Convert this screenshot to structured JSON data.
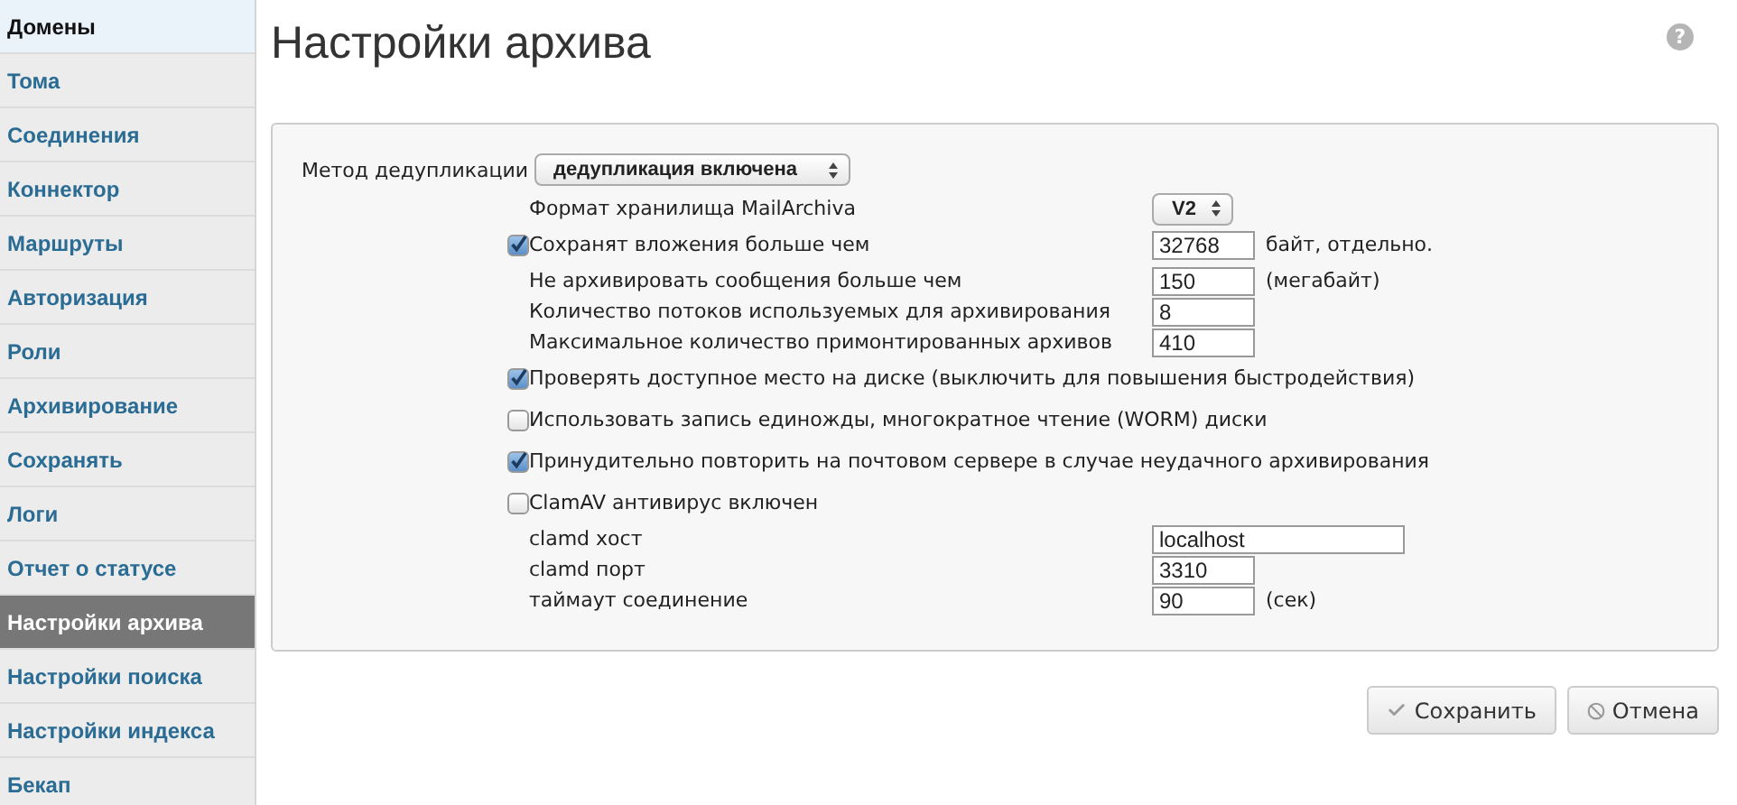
{
  "sidebar": {
    "items": [
      {
        "label": "Домены",
        "selected": false,
        "highlighted": true
      },
      {
        "label": "Тома",
        "selected": false,
        "highlighted": false
      },
      {
        "label": "Соединения",
        "selected": false,
        "highlighted": false
      },
      {
        "label": "Коннектор",
        "selected": false,
        "highlighted": false
      },
      {
        "label": "Маршруты",
        "selected": false,
        "highlighted": false
      },
      {
        "label": "Авторизация",
        "selected": false,
        "highlighted": false
      },
      {
        "label": "Роли",
        "selected": false,
        "highlighted": false
      },
      {
        "label": "Архивирование",
        "selected": false,
        "highlighted": false
      },
      {
        "label": "Сохранять",
        "selected": false,
        "highlighted": false
      },
      {
        "label": "Логи",
        "selected": false,
        "highlighted": false
      },
      {
        "label": "Отчет о статусе",
        "selected": false,
        "highlighted": false
      },
      {
        "label": "Настройки архива",
        "selected": true,
        "highlighted": false
      },
      {
        "label": "Настройки поиска",
        "selected": false,
        "highlighted": false
      },
      {
        "label": "Настройки индекса",
        "selected": false,
        "highlighted": false
      },
      {
        "label": "Бекап",
        "selected": false,
        "highlighted": false
      }
    ]
  },
  "page": {
    "title": "Настройки архива",
    "help": "?"
  },
  "settings": {
    "dedup": {
      "label": "Метод дедупликации",
      "value": "дедупликация включена"
    },
    "rows": [
      {
        "kind": "select",
        "label": "Формат хранилища MailArchiva",
        "value": "V2"
      },
      {
        "kind": "number",
        "checked": true,
        "label": "Сохранят вложения больше чем",
        "value": "32768",
        "suffix": "байт, отдельно."
      },
      {
        "kind": "number",
        "label": "Не архивировать сообщения больше чем",
        "value": "150",
        "suffix": "(мегабайт)"
      },
      {
        "kind": "number",
        "label": "Количество потоков используемых для архивирования",
        "value": "8"
      },
      {
        "kind": "number",
        "label": "Максимальное количество примонтированных архивов",
        "value": "410"
      },
      {
        "kind": "plain",
        "checked": true,
        "label": "Проверять доступное место на диске (выключить для повышения быстродействия)"
      },
      {
        "kind": "plain",
        "checked": false,
        "label": "Использовать запись единожды, многократное чтение (WORM) диски"
      },
      {
        "kind": "plain",
        "checked": true,
        "label": "Принудительно повторить на почтовом сервере в случае неудачного архивирования"
      },
      {
        "kind": "plain",
        "checked": false,
        "label": "ClamAV антивирус включен"
      },
      {
        "kind": "text",
        "label": "clamd хост",
        "value": "localhost"
      },
      {
        "kind": "number",
        "label": "clamd порт",
        "value": "3310"
      },
      {
        "kind": "number",
        "label": "таймаут соединение",
        "value": "90",
        "suffix": "(сек)"
      }
    ]
  },
  "buttons": [
    {
      "kind": "save",
      "label": "Сохранить"
    },
    {
      "kind": "cancel",
      "label": "Отмена"
    }
  ]
}
